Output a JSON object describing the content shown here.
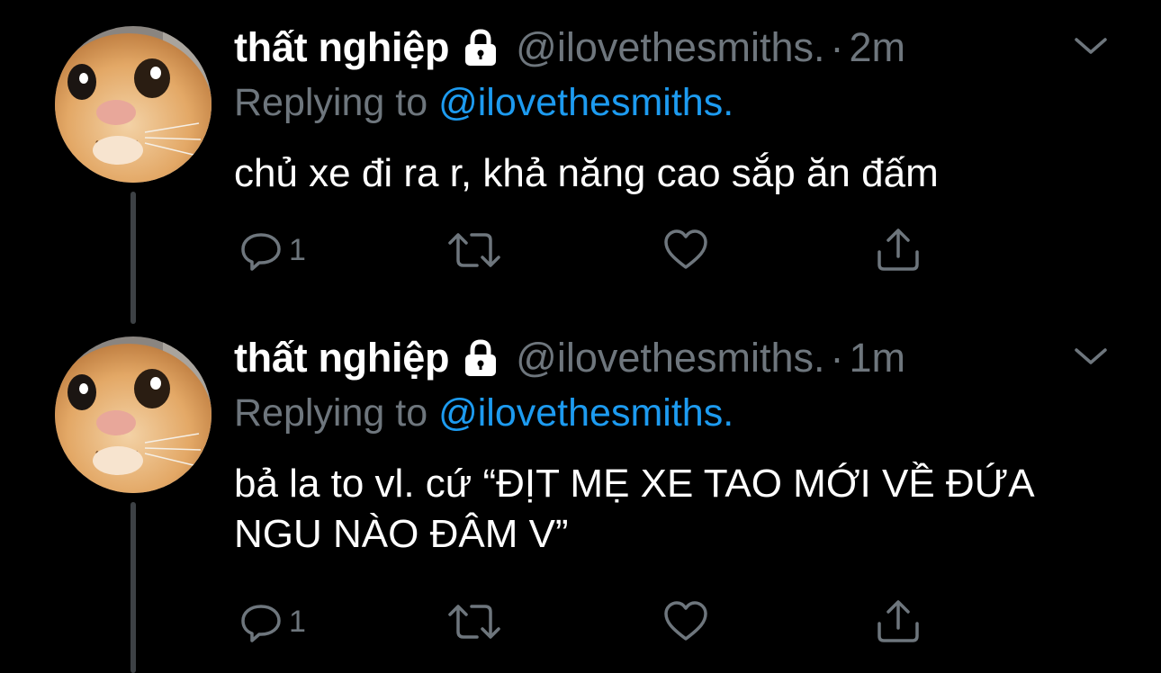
{
  "tweets": [
    {
      "display_name": "thất nghiệp",
      "handle": "@ilovethesmiths.",
      "separator": "·",
      "timestamp": "2m",
      "replying_prefix": "Replying to",
      "replying_handle": "@ilovethesmiths.",
      "text": "chủ xe đi ra r, khả năng cao sắp ăn đấm",
      "reply_count": "1",
      "icons": [
        "lock-icon",
        "chevron-down-icon",
        "reply-icon",
        "retweet-icon",
        "like-icon",
        "share-icon"
      ]
    },
    {
      "display_name": "thất nghiệp",
      "handle": "@ilovethesmiths.",
      "separator": "·",
      "timestamp": "1m",
      "replying_prefix": "Replying to",
      "replying_handle": "@ilovethesmiths.",
      "text": "bả la to vl. cứ “ĐỊT MẸ XE TAO MỚI VỀ ĐỨA NGU NÀO ĐÂM V”",
      "reply_count": "1",
      "icons": [
        "lock-icon",
        "chevron-down-icon",
        "reply-icon",
        "retweet-icon",
        "like-icon",
        "share-icon"
      ]
    }
  ],
  "colors": {
    "background": "#000000",
    "primary_text": "#ffffff",
    "secondary_text": "#6e767d",
    "link": "#1d9bf0",
    "thread_line": "#3d4145"
  }
}
